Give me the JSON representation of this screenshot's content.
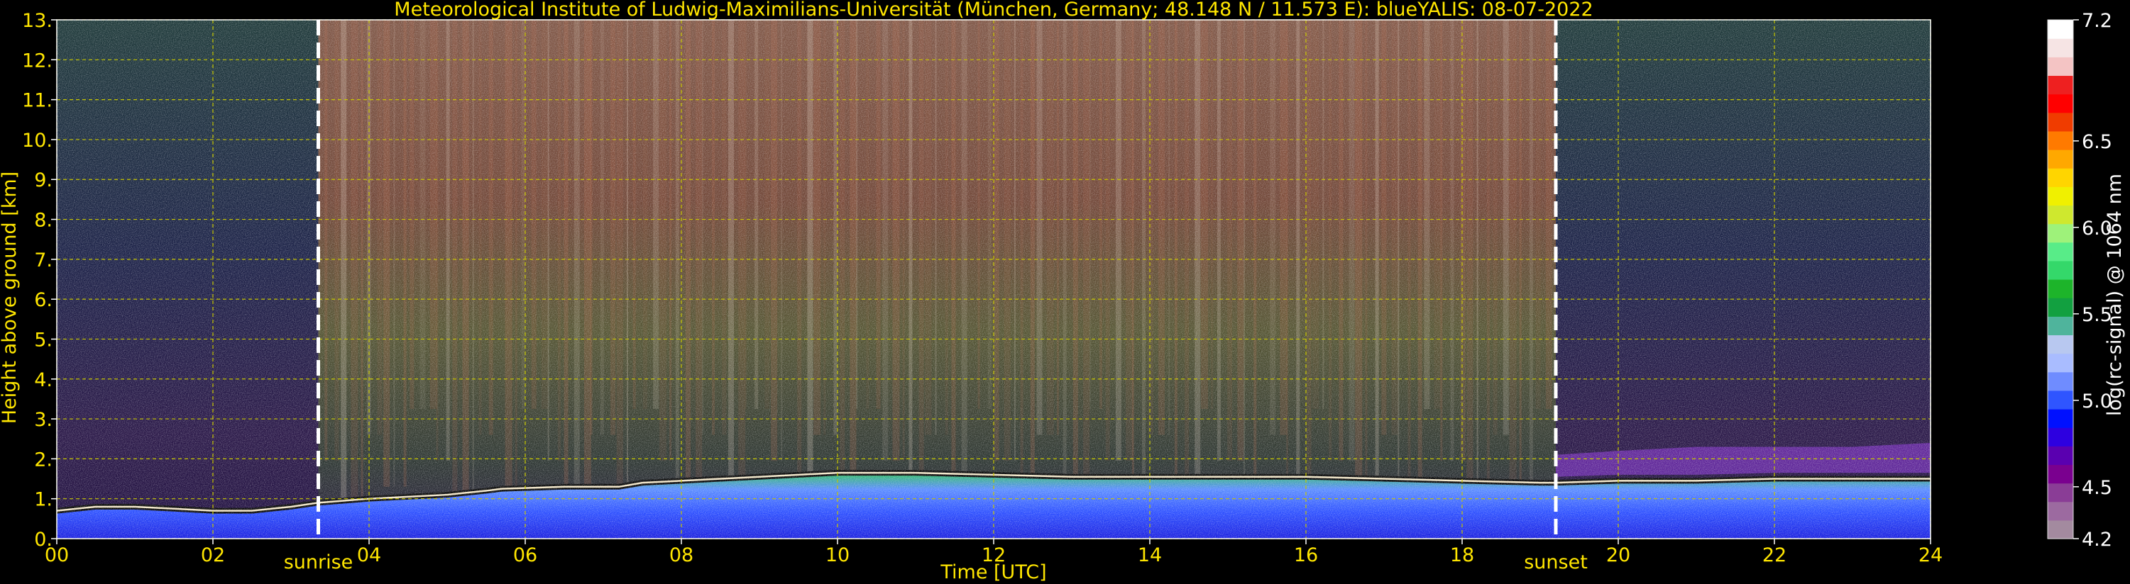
{
  "chart_data": {
    "type": "heatmap",
    "title": "Meteorological Institute of Ludwig-Maximilians-Universität (München, Germany; 48.148 N / 11.573 E):    blueYALIS: 08-07-2022",
    "xlabel": "Time [UTC]",
    "ylabel": "Height above ground [km]",
    "colorbar_label": "log(rc-signal) @ 1064 nm",
    "xlim": [
      0,
      24
    ],
    "ylim": [
      0,
      13
    ],
    "x_ticks": [
      "00",
      "02",
      "04",
      "06",
      "08",
      "10",
      "12",
      "14",
      "16",
      "18",
      "20",
      "22",
      "24"
    ],
    "x_tick_values": [
      0,
      2,
      4,
      6,
      8,
      10,
      12,
      14,
      16,
      18,
      20,
      22,
      24
    ],
    "y_ticks": [
      "0.",
      "1.",
      "2.",
      "3.",
      "4.",
      "5.",
      "6.",
      "7.",
      "8.",
      "9.",
      "10.",
      "11.",
      "12.",
      "13."
    ],
    "y_tick_values": [
      0,
      1,
      2,
      3,
      4,
      5,
      6,
      7,
      8,
      9,
      10,
      11,
      12,
      13
    ],
    "colorbar_range": [
      4.2,
      7.2
    ],
    "colorbar_ticks": [
      "4.2",
      "4.5",
      "5.0",
      "5.5",
      "6.0",
      "6.5",
      "7.2"
    ],
    "colorbar_tick_values": [
      4.2,
      4.5,
      5.0,
      5.5,
      6.0,
      6.5,
      7.2
    ],
    "colorbar_colors": [
      "#a38a9f",
      "#9c6aa0",
      "#8a3d96",
      "#7a008f",
      "#5a00b0",
      "#2d00e0",
      "#0010ff",
      "#2f55ff",
      "#6f8cff",
      "#a9bcff",
      "#b8c8f0",
      "#4fb49c",
      "#12a040",
      "#1db42a",
      "#34d86a",
      "#58ec88",
      "#9ef27a",
      "#cfe82e",
      "#f0f000",
      "#ffd500",
      "#ffa800",
      "#ff7a00",
      "#f03c00",
      "#ff0000",
      "#ee2020",
      "#f4c4c4",
      "#f6e4e4",
      "#ffffff"
    ],
    "grid": true,
    "grid_color": "#c8c800",
    "annotations": [
      {
        "label": "sunrise",
        "x": 3.35
      },
      {
        "label": "sunset",
        "x": 19.2
      }
    ],
    "boundary_layer_top_km": [
      [
        0.0,
        0.7
      ],
      [
        0.5,
        0.8
      ],
      [
        1.0,
        0.8
      ],
      [
        1.5,
        0.75
      ],
      [
        2.0,
        0.7
      ],
      [
        2.5,
        0.7
      ],
      [
        3.0,
        0.8
      ],
      [
        3.35,
        0.9
      ],
      [
        4.0,
        1.0
      ],
      [
        4.5,
        1.05
      ],
      [
        5.0,
        1.1
      ],
      [
        5.5,
        1.2
      ],
      [
        5.7,
        1.25
      ],
      [
        6.5,
        1.3
      ],
      [
        7.0,
        1.3
      ],
      [
        7.2,
        1.3
      ],
      [
        7.5,
        1.4
      ],
      [
        8.0,
        1.45
      ],
      [
        8.5,
        1.5
      ],
      [
        9.0,
        1.55
      ],
      [
        9.5,
        1.6
      ],
      [
        10.0,
        1.65
      ],
      [
        11.0,
        1.65
      ],
      [
        12.0,
        1.6
      ],
      [
        13.0,
        1.55
      ],
      [
        14.0,
        1.55
      ],
      [
        15.0,
        1.55
      ],
      [
        16.0,
        1.55
      ],
      [
        17.0,
        1.5
      ],
      [
        18.0,
        1.45
      ],
      [
        19.0,
        1.4
      ],
      [
        19.2,
        1.4
      ],
      [
        20.0,
        1.45
      ],
      [
        21.0,
        1.45
      ],
      [
        22.0,
        1.5
      ],
      [
        23.0,
        1.5
      ],
      [
        24.0,
        1.5
      ]
    ],
    "aerosol_layer_top_km": [
      [
        19.2,
        2.1
      ],
      [
        20.0,
        2.2
      ],
      [
        21.0,
        2.3
      ],
      [
        22.0,
        2.3
      ],
      [
        23.0,
        2.3
      ],
      [
        24.0,
        2.4
      ]
    ]
  }
}
